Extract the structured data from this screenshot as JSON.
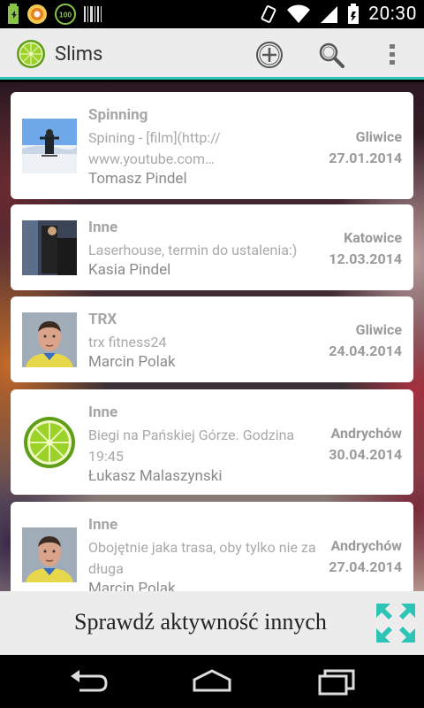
{
  "statusbar": {
    "time": "20:30",
    "icons": [
      "battery-icon",
      "notification-circle-icon",
      "100-badge-icon",
      "barcode-icon",
      "vibrate-icon",
      "wifi-icon",
      "signal-icon",
      "battery-charging-icon"
    ]
  },
  "actionbar": {
    "title": "Slims",
    "actions": [
      "add-icon",
      "search-icon",
      "overflow-menu-icon"
    ]
  },
  "cards": [
    {
      "category": "Spinning",
      "description": "Spining - [film](http://\nwww.youtube.com…",
      "user": "Tomasz Pindel",
      "city": "Gliwice",
      "date": "27.01.2014",
      "thumb": "snow-photo"
    },
    {
      "category": "Inne",
      "description": "Laserhouse, termin do ustalenia:)",
      "user": "Kasia Pindel",
      "city": "Katowice",
      "date": "12.03.2014",
      "thumb": "dark-room-photo"
    },
    {
      "category": "TRX",
      "description": "trx fitness24",
      "user": "Marcin Polak",
      "city": "Gliwice",
      "date": "24.04.2014",
      "thumb": "portrait-photo"
    },
    {
      "category": "Inne",
      "description": "Biegi na Pańskiej Górze. Godzina 19:45",
      "user": "Łukasz Malaszynski",
      "city": "Andrychów",
      "date": "30.04.2014",
      "thumb": "lime-icon"
    },
    {
      "category": "Inne",
      "description": "Obojętnie jaka trasa, oby tylko nie za długa",
      "user": "Marcin Polak",
      "city": "Andrychów",
      "date": "27.04.2014",
      "thumb": "portrait-photo"
    }
  ],
  "bottombar": {
    "label": "Sprawdź aktywność innych",
    "icon": "expand-arrows-icon"
  },
  "colors": {
    "accent": "#2ec4b6",
    "lime": "#8fc31f"
  }
}
